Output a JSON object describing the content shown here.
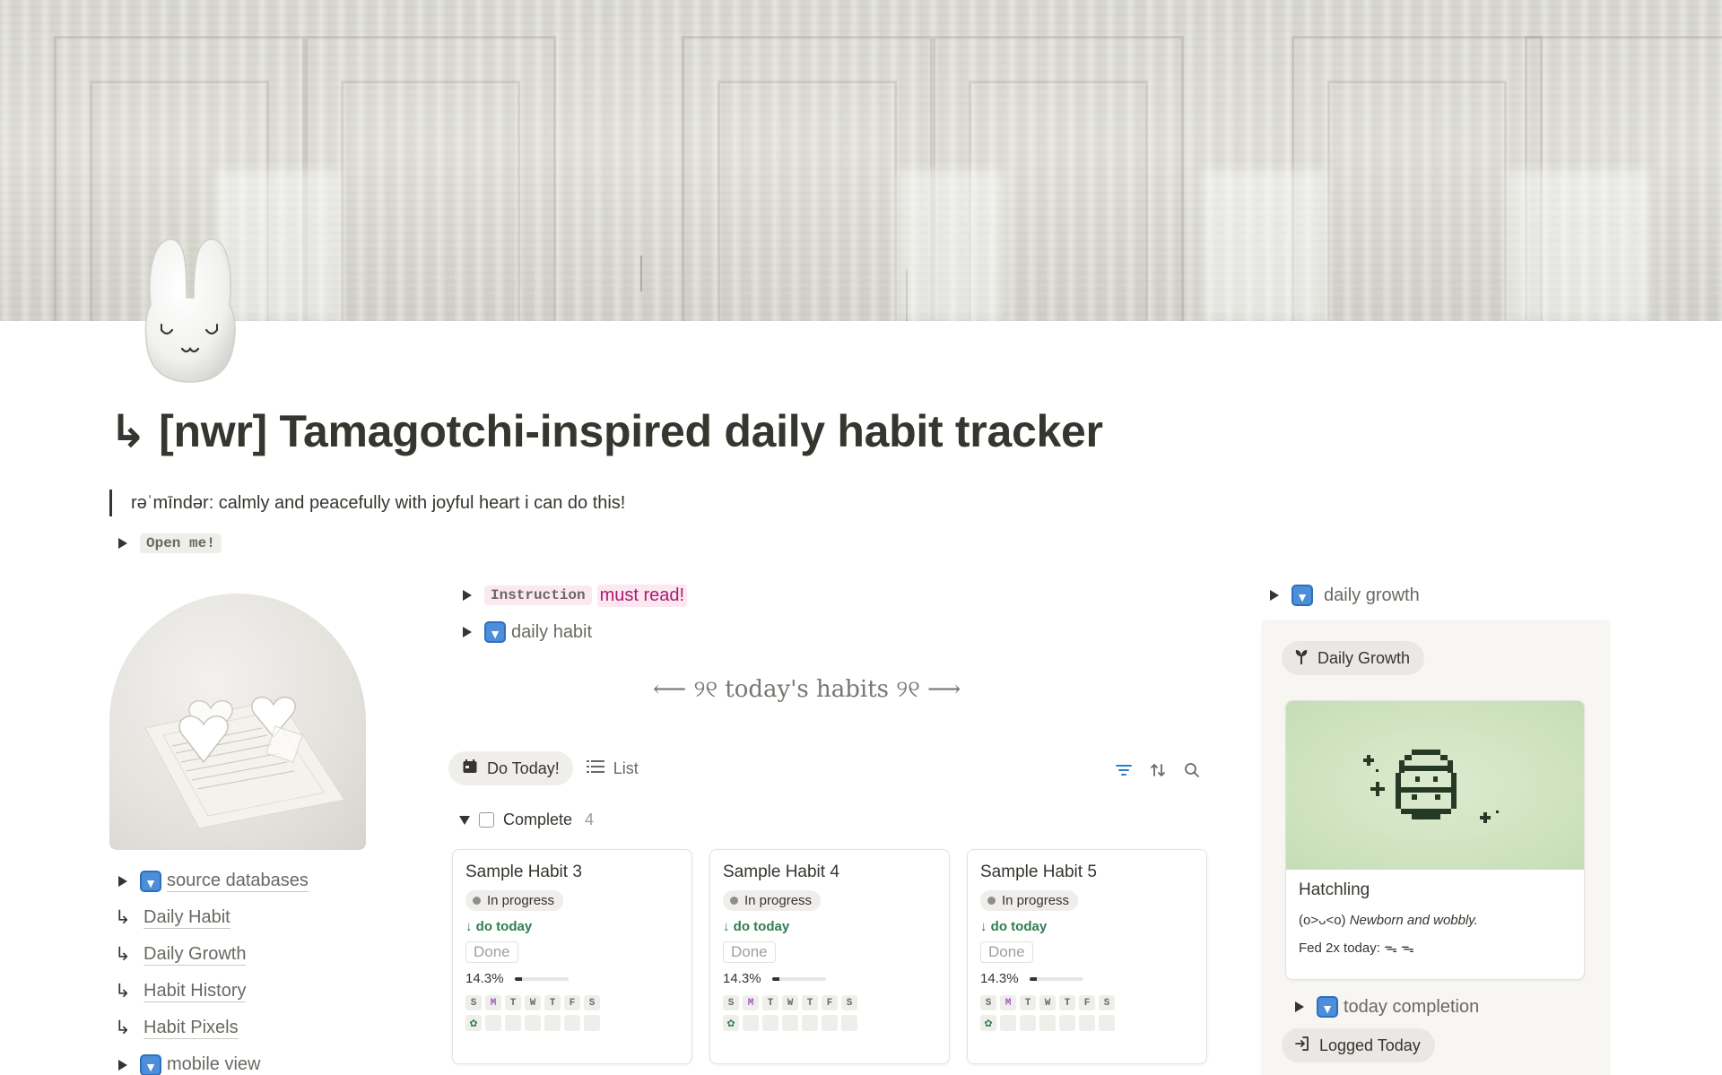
{
  "page": {
    "title": "↳ [nwr] Tamagotchi-inspired daily habit tracker",
    "reminder": "rəˈmīndər: calmly and peacefully with joyful heart i can do this!",
    "open_me": "Open me!"
  },
  "left": {
    "source_databases": "source databases",
    "links": [
      {
        "arrow": "↳",
        "label": "Daily Habit"
      },
      {
        "arrow": "↳",
        "label": "Daily Growth"
      },
      {
        "arrow": "↳",
        "label": "Habit History"
      },
      {
        "arrow": "↳",
        "label": "Habit Pixels"
      }
    ],
    "mobile_view": "mobile view"
  },
  "middle": {
    "instruction_code": "Instruction",
    "instruction_note": "must read!",
    "daily_habit": "daily habit",
    "section_title": "⟵ ୨୧ today's habits ୨୧ ⟶",
    "tabs": [
      {
        "label": "Do Today!",
        "icon": "calendar-icon",
        "active": true
      },
      {
        "label": "List",
        "icon": "list-icon",
        "active": false
      }
    ],
    "group": {
      "label": "Complete",
      "count": "4"
    },
    "day_letters": [
      "S",
      "M",
      "T",
      "W",
      "T",
      "F",
      "S"
    ],
    "cards": [
      {
        "title": "Sample Habit 3",
        "status": "In progress",
        "do_today": "↓ do today",
        "done": "Done",
        "percent": "14.3%",
        "progress": 0.143
      },
      {
        "title": "Sample Habit 4",
        "status": "In progress",
        "do_today": "↓ do today",
        "done": "Done",
        "percent": "14.3%",
        "progress": 0.143
      },
      {
        "title": "Sample Habit 5",
        "status": "In progress",
        "do_today": "↓ do today",
        "done": "Done",
        "percent": "14.3%",
        "progress": 0.143
      }
    ],
    "check_mark": "✿"
  },
  "right": {
    "daily_growth_toggle": "daily growth",
    "chip_label": "Daily Growth",
    "card": {
      "title": "Hatchling",
      "face": "(о>ᴗ<о)",
      "desc": "Newborn and wobbly.",
      "fed": "Fed 2x today:",
      "fed_icons": "ᯓ ᯓ"
    },
    "today_completion": "today completion",
    "logged_today": "Logged Today"
  },
  "colors": {
    "text": "#37352f",
    "muted": "#6b6863",
    "green": "#2f7d4f",
    "pink": "#ad1a72",
    "accent_blue": "#2e7dc9"
  }
}
